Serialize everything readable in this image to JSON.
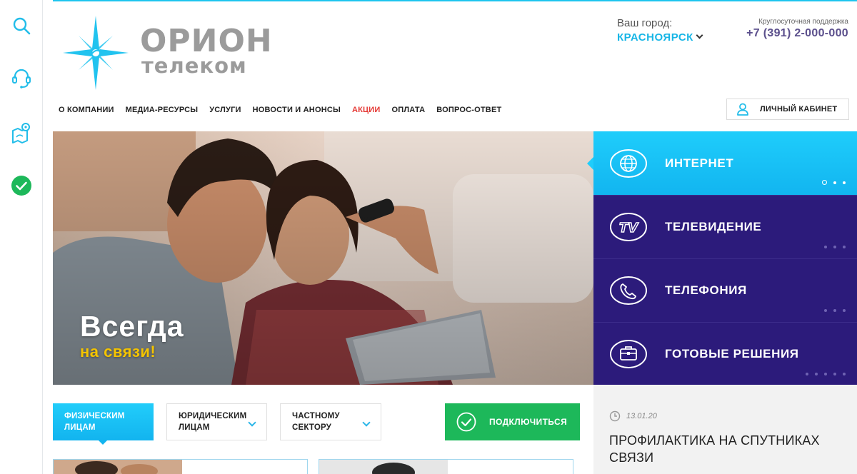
{
  "brand": {
    "line1": "ОРИОН",
    "line2": "телеком",
    "accent": "#1ec5ee",
    "purple": "#2c1b7b"
  },
  "rail": {
    "items": [
      {
        "icon": "search-icon"
      },
      {
        "icon": "headset-icon"
      },
      {
        "icon": "map-pin-icon"
      },
      {
        "icon": "check-circle-icon"
      }
    ]
  },
  "city": {
    "label": "Ваш город:",
    "value": "КРАСНОЯРСК"
  },
  "support": {
    "label": "Круглосуточная поддержка",
    "phone": "+7 (391) 2-000-000"
  },
  "nav": {
    "items": [
      {
        "label": "О КОМПАНИИ"
      },
      {
        "label": "МЕДИА-РЕСУРСЫ"
      },
      {
        "label": "УСЛУГИ"
      },
      {
        "label": "НОВОСТИ И АНОНСЫ"
      },
      {
        "label": "АКЦИИ"
      },
      {
        "label": "ОПЛАТА"
      },
      {
        "label": "ВОПРОС-ОТВЕТ"
      }
    ],
    "cabinet": "ЛИЧНЫЙ КАБИНЕТ"
  },
  "hero": {
    "title": "Всегда",
    "subtitle": "на связи!"
  },
  "services": {
    "items": [
      {
        "label": "ИНТЕРНЕТ",
        "icon": "globe-icon",
        "active": true
      },
      {
        "label": "ТЕЛЕВИДЕНИЕ",
        "icon": "tv-icon",
        "active": false
      },
      {
        "label": "ТЕЛЕФОНИЯ",
        "icon": "phone-icon",
        "active": false
      },
      {
        "label": "ГОТОВЫЕ РЕШЕНИЯ",
        "icon": "briefcase-icon",
        "active": false
      }
    ]
  },
  "segments": {
    "tabs": [
      {
        "line1": "ФИЗИЧЕСКИМ",
        "line2": "ЛИЦАМ",
        "active": true
      },
      {
        "line1": "ЮРИДИЧЕСКИМ",
        "line2": "ЛИЦАМ",
        "active": false
      },
      {
        "line1": "ЧАСТНОМУ",
        "line2": "СЕКТОРУ",
        "active": false
      }
    ],
    "connect": "ПОДКЛЮЧИТЬСЯ"
  },
  "news": {
    "date": "13.01.20",
    "title": "ПРОФИЛАКТИКА НА СПУТНИКАХ СВЯЗИ"
  }
}
